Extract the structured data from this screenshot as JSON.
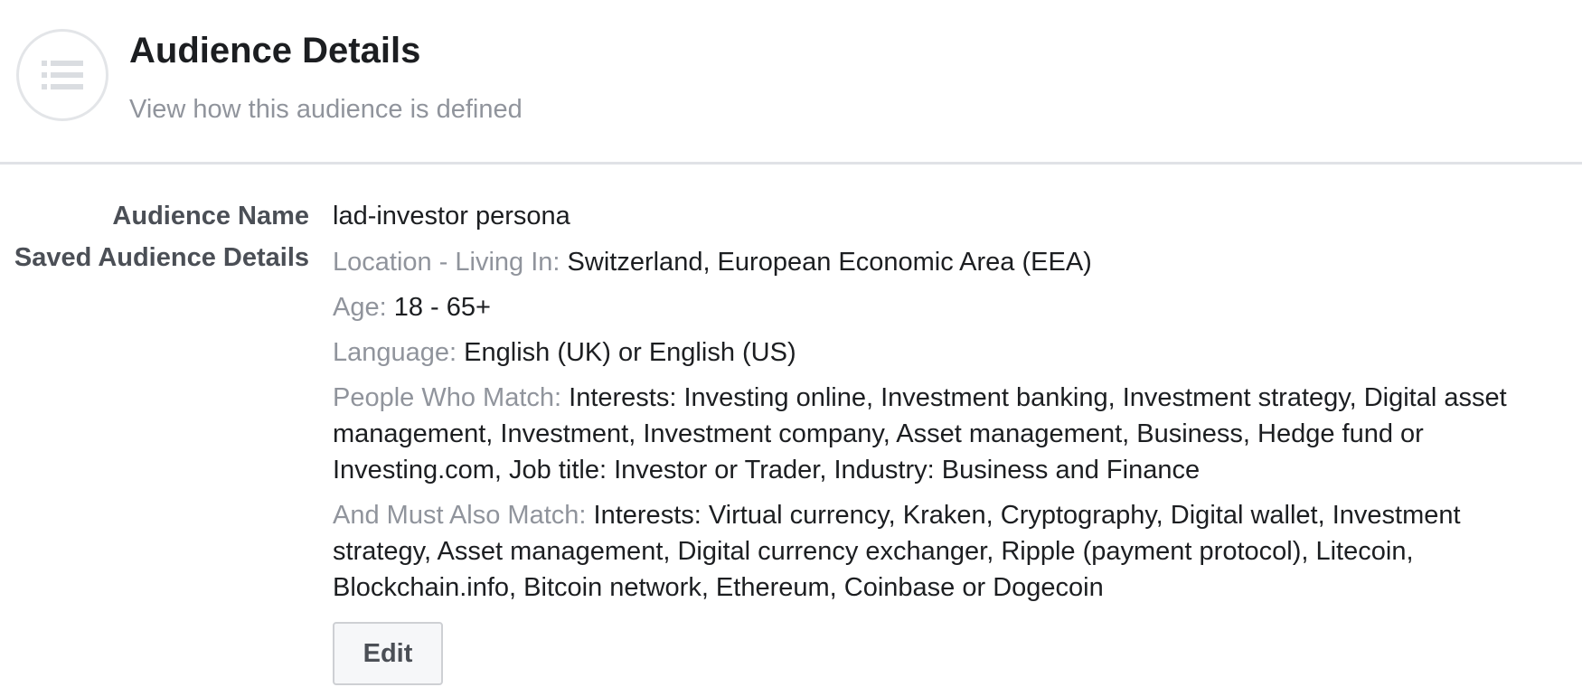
{
  "header": {
    "icon": "list-icon",
    "title": "Audience Details",
    "subtitle": "View how this audience is defined"
  },
  "details": {
    "audience_name_label": "Audience Name",
    "audience_name_value": "lad-investor persona",
    "saved_details_label": "Saved Audience Details",
    "criteria": [
      {
        "label": "Location - Living In:",
        "value": "Switzerland, European Economic Area (EEA)"
      },
      {
        "label": "Age:",
        "value": "18 - 65+"
      },
      {
        "label": "Language:",
        "value": "English (UK) or English (US)"
      },
      {
        "label": "People Who Match:",
        "value": "Interests: Investing online, Investment banking, Investment strategy, Digital asset management, Investment, Investment company, Asset management, Business, Hedge fund or Investing.com, Job title: Investor or Trader, Industry: Business and Finance"
      },
      {
        "label": "And Must Also Match:",
        "value": "Interests: Virtual currency, Kraken, Cryptography, Digital wallet, Investment strategy, Asset management, Digital currency exchanger, Ripple (payment protocol), Litecoin, Blockchain.info, Bitcoin network, Ethereum, Coinbase or Dogecoin"
      }
    ],
    "edit_label": "Edit"
  }
}
